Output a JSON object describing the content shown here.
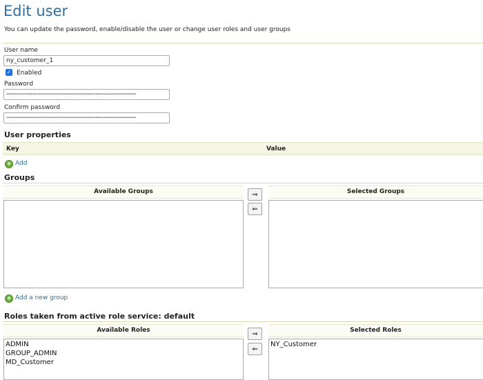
{
  "header": {
    "title": "Edit user",
    "subtitle": "You can update the password, enable/disable the user or change user roles and user groups"
  },
  "form": {
    "username_label": "User name",
    "username_value": "ny_customer_1",
    "enabled_label": "Enabled",
    "enabled_checked": true,
    "password_label": "Password",
    "password_value": "••••••••••••••••••••••••••••••••••••••••••••••••••••••••••••••••••••••••••••••••",
    "confirm_label": "Confirm password",
    "confirm_value": "••••••••••••••••••••••••••••••••••••••••••••••••••••••••••••••••••••••••••••••••"
  },
  "user_properties": {
    "heading": "User properties",
    "key_header": "Key",
    "value_header": "Value",
    "add_label": "Add"
  },
  "groups": {
    "heading": "Groups",
    "available_header": "Available Groups",
    "selected_header": "Selected Groups",
    "available": [],
    "selected": [],
    "add_right": "⇒",
    "add_left": "⇐",
    "add_group_label": "Add a new group"
  },
  "roles": {
    "heading": "Roles taken from active role service: default",
    "available_header": "Available Roles",
    "selected_header": "Selected Roles",
    "available": [
      "ADMIN",
      "GROUP_ADMIN",
      "MD_Customer"
    ],
    "selected": [
      "NY_Customer"
    ],
    "add_right": "⇒",
    "add_left": "⇐"
  },
  "colors": {
    "title": "#2f6f9f",
    "link": "#2f6f9f",
    "table_header_bg": "#f4f6e3",
    "checkbox": "#1a73e8",
    "add_icon": "#6cb13a"
  }
}
